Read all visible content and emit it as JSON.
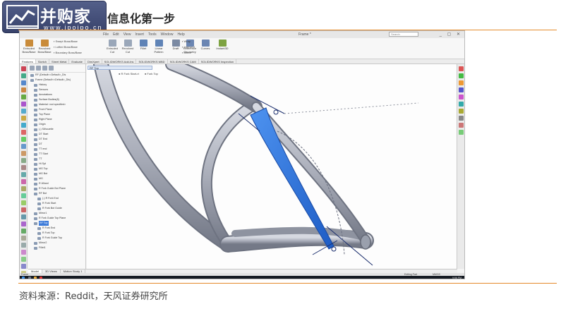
{
  "brand": {
    "name": "并购家",
    "site": "www.ipoipo.cn"
  },
  "heading": "信息化第一步",
  "source_label": "资料来源：Reddit，天风证券研究所",
  "app": {
    "menu": [
      "File",
      "Edit",
      "View",
      "Insert",
      "Tools",
      "Window",
      "Help"
    ],
    "document_title": "Frame *",
    "search_placeholder": "Search",
    "window_controls": "_ ▢ ✕",
    "ribbon": {
      "buttons": [
        {
          "label": "Extruded Boss/Base",
          "color": "#c98b3a"
        },
        {
          "label": "Revolved Boss/Base",
          "color": "#c98b3a"
        },
        {
          "label": "Extruded Cut",
          "color": "#9aa7b9"
        },
        {
          "label": "Revolved Cut",
          "color": "#9aa7b9"
        },
        {
          "label": "Fillet",
          "color": "#5f83b6"
        },
        {
          "label": "Linear Pattern",
          "color": "#5f83b6"
        },
        {
          "label": "Draft",
          "color": "#7b8aa3"
        },
        {
          "label": "Reference Geometry",
          "color": "#6b86b3"
        },
        {
          "label": "Curves",
          "color": "#6b86b3"
        },
        {
          "label": "Instant3D",
          "color": "#7ea342"
        }
      ],
      "small": [
        "Swept Boss/Base",
        "Lofted Boss/Base",
        "Boundary Boss/Base",
        "Wrap",
        "Intersect",
        "Mirror"
      ]
    },
    "command_tabs": [
      "Features",
      "Sketch",
      "Sheet Metal",
      "Evaluate",
      "DimXpert",
      "SOLIDWORKS Add-Ins",
      "SOLIDWORKS MBD",
      "SOLIDWORKS CAM",
      "SOLIDWORKS Inspection"
    ],
    "active_command_tab": "Features",
    "viewport_strip": "RF Top",
    "breadcrumb": [
      "R Fork Start-rt",
      "Fork Top"
    ],
    "tree": [
      {
        "label": "RF (Default<<Default>_Dis",
        "indent": 0
      },
      {
        "label": "Frame (Default<<Default>_Dis)",
        "indent": 0
      },
      {
        "label": "History",
        "indent": 1
      },
      {
        "label": "Sensors",
        "indent": 1
      },
      {
        "label": "Annotations",
        "indent": 1
      },
      {
        "label": "Surface Bodies(8)",
        "indent": 1
      },
      {
        "label": "Material <not specified>",
        "indent": 1
      },
      {
        "label": "Front Plane",
        "indent": 1
      },
      {
        "label": "Top Plane",
        "indent": 1
      },
      {
        "label": "Right Plane",
        "indent": 1
      },
      {
        "label": "Origin",
        "indent": 1
      },
      {
        "label": "(-) Silhouette",
        "indent": 1
      },
      {
        "label": "DT Start",
        "indent": 1
      },
      {
        "label": "DT End",
        "indent": 1
      },
      {
        "label": "DT",
        "indent": 1
      },
      {
        "label": "TT end",
        "indent": 1
      },
      {
        "label": "TT Start",
        "indent": 1
      },
      {
        "label": "TT",
        "indent": 1
      },
      {
        "label": "Ht Spt",
        "indent": 1
      },
      {
        "label": "MG Top",
        "indent": 1
      },
      {
        "label": "MG Bot",
        "indent": 1
      },
      {
        "label": "MG",
        "indent": 1
      },
      {
        "label": "R Wheel",
        "indent": 1
      },
      {
        "label": "R Fork Guide Bot Plane",
        "indent": 1
      },
      {
        "label": "RF Bot",
        "indent": 1
      },
      {
        "label": "(-) R Fork End",
        "indent": 2
      },
      {
        "label": "R Fork Start",
        "indent": 2
      },
      {
        "label": "R Fork Bot Guide",
        "indent": 2
      },
      {
        "label": "Mirror1",
        "indent": 1
      },
      {
        "label": "R Fork Guide Top Plane",
        "indent": 1
      },
      {
        "label": "RF Top",
        "indent": 1,
        "selected": true
      },
      {
        "label": "R Fork End",
        "indent": 2
      },
      {
        "label": "R Fork Top",
        "indent": 2
      },
      {
        "label": "R Fork Guide Top",
        "indent": 2
      },
      {
        "label": "Mirror2",
        "indent": 1
      },
      {
        "label": "Fillet1",
        "indent": 1
      }
    ],
    "bottom_tabs": [
      "Model",
      "3D Views",
      "Motion Study 1"
    ],
    "active_bottom_tab": "Model",
    "status": {
      "left": "Frame",
      "mode": "Editing Part",
      "units": "MMGS"
    },
    "clock": "9:56 PM",
    "model_colors": {
      "frame": "#a9adb9",
      "highlight": "#2b6fd6",
      "dimension": "#1c2f6d"
    }
  }
}
